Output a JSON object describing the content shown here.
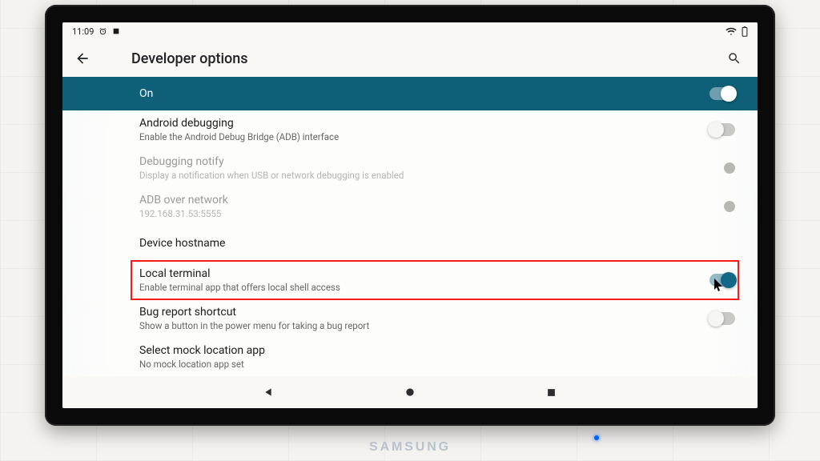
{
  "statusbar": {
    "time": "11:09"
  },
  "appbar": {
    "title": "Developer options"
  },
  "master": {
    "label": "On",
    "enabled": true
  },
  "settings": [
    {
      "key": "android_debugging",
      "title": "Android debugging",
      "subtitle": "Enable the Android Debug Bridge (ADB) interface",
      "control": "switch",
      "enabled": false,
      "disabled": false
    },
    {
      "key": "debugging_notify",
      "title": "Debugging notify",
      "subtitle": "Display a notification when USB or network debugging is enabled",
      "control": "dot",
      "enabled": false,
      "disabled": true
    },
    {
      "key": "adb_over_network",
      "title": "ADB over network",
      "subtitle": "192.168.31.53:5555",
      "control": "dot",
      "enabled": false,
      "disabled": true
    },
    {
      "key": "device_hostname",
      "title": "Device hostname",
      "subtitle": "",
      "control": "none",
      "enabled": false,
      "disabled": false
    },
    {
      "key": "local_terminal",
      "title": "Local terminal",
      "subtitle": "Enable terminal app that offers local shell access",
      "control": "switch",
      "enabled": true,
      "disabled": false,
      "highlighted": true
    },
    {
      "key": "bug_report_shortcut",
      "title": "Bug report shortcut",
      "subtitle": "Show a button in the power menu for taking a bug report",
      "control": "switch",
      "enabled": false,
      "disabled": false
    },
    {
      "key": "select_mock_location",
      "title": "Select mock location app",
      "subtitle": "No mock location app set",
      "control": "none",
      "enabled": false,
      "disabled": false
    }
  ],
  "tv_brand": "SAMSUNG",
  "colors": {
    "accent": "#0f5f78",
    "highlight": "#ff1a1a"
  }
}
